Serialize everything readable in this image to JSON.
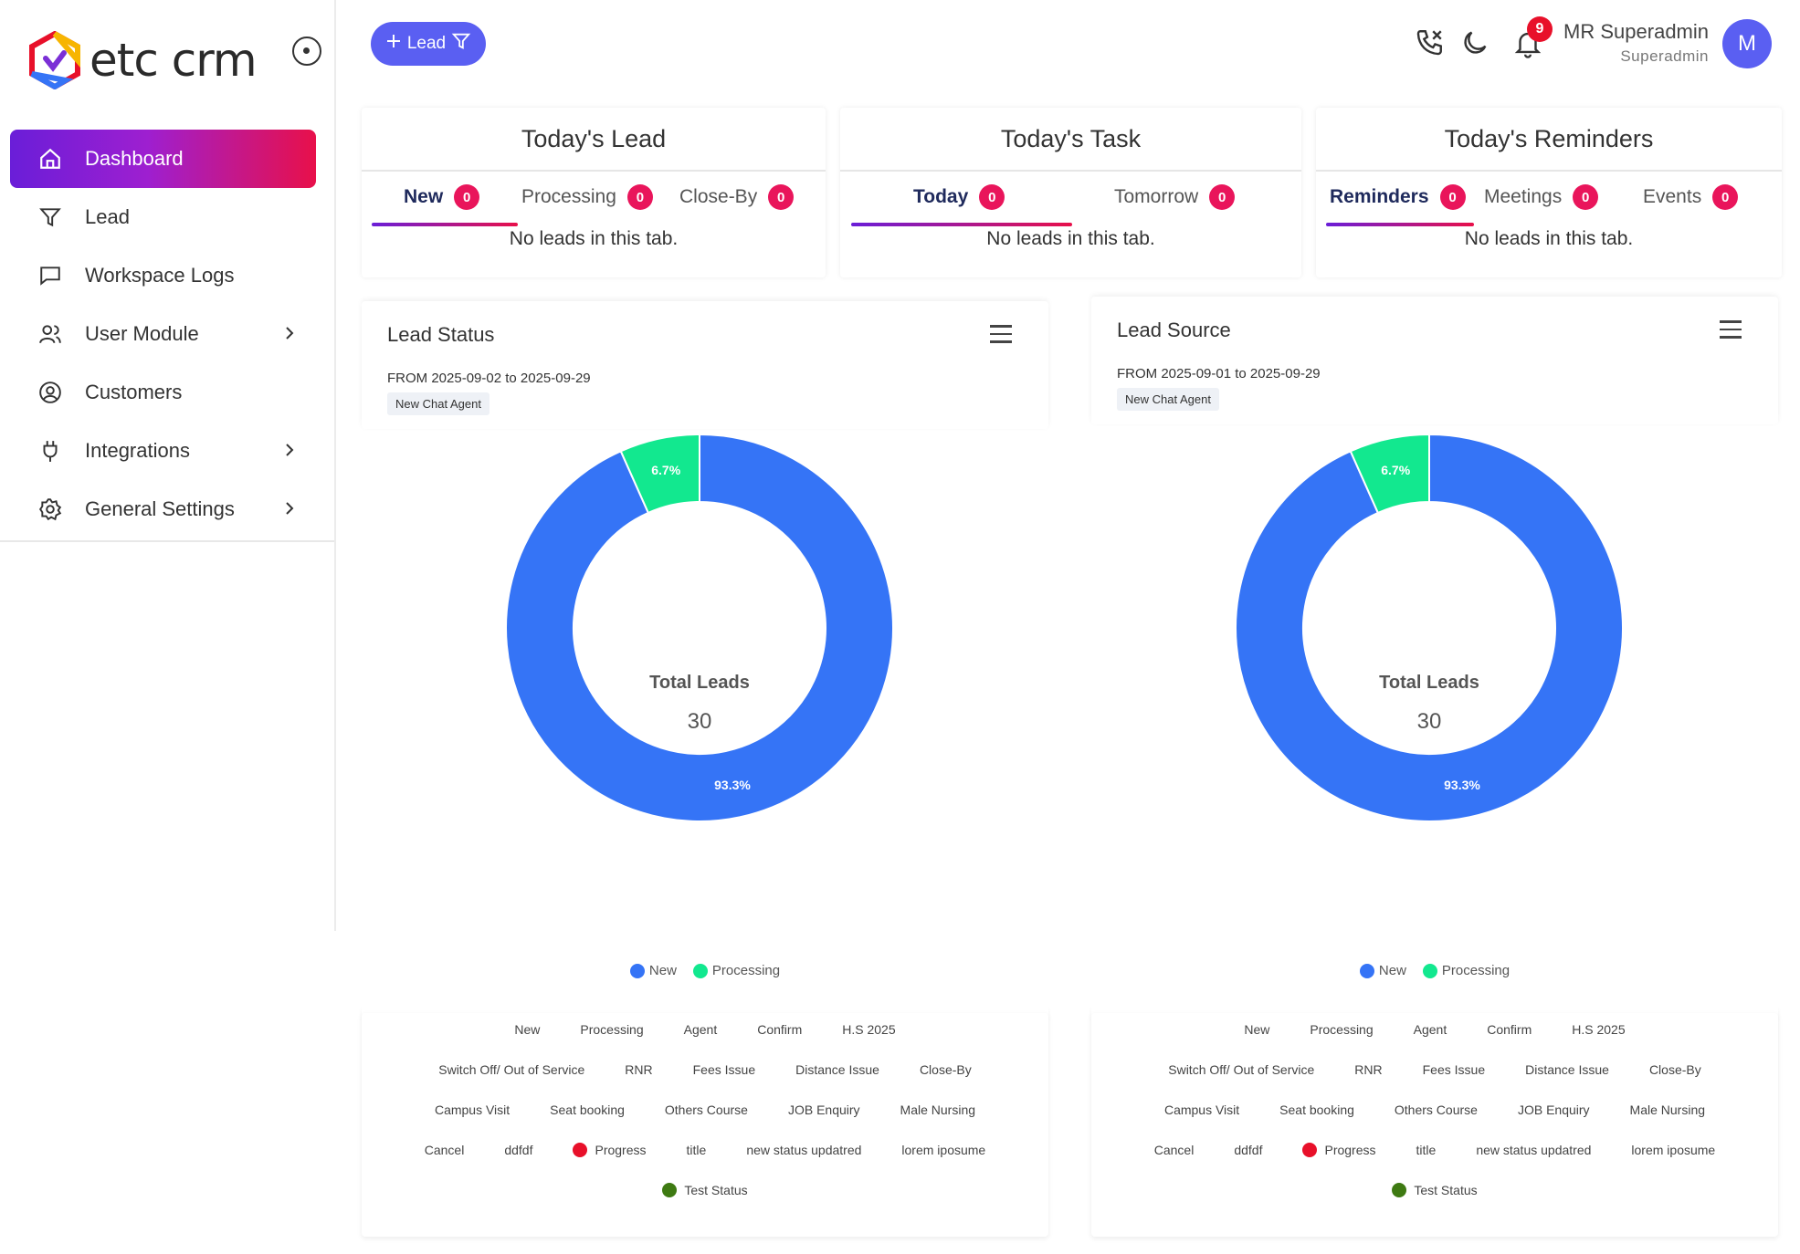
{
  "app": {
    "name": "etc crm"
  },
  "sidebar": {
    "items": [
      {
        "label": "Dashboard",
        "icon": "home-icon",
        "active": true
      },
      {
        "label": "Lead",
        "icon": "funnel-icon"
      },
      {
        "label": "Workspace Logs",
        "icon": "chat-icon"
      },
      {
        "label": "User Module",
        "icon": "users-icon",
        "expandable": true
      },
      {
        "label": "Customers",
        "icon": "user-circle-icon"
      },
      {
        "label": "Integrations",
        "icon": "plug-icon",
        "expandable": true
      },
      {
        "label": "General Settings",
        "icon": "gear-icon",
        "expandable": true
      }
    ]
  },
  "topbar": {
    "lead_button": "Lead",
    "notifications_count": "9",
    "user_name": "MR Superadmin",
    "user_role": "Superadmin",
    "avatar_initial": "M"
  },
  "cards": {
    "lead": {
      "title": "Today's Lead",
      "tabs": [
        {
          "label": "New",
          "count": "0"
        },
        {
          "label": "Processing",
          "count": "0"
        },
        {
          "label": "Close-By",
          "count": "0"
        }
      ],
      "empty": "No leads in this tab."
    },
    "task": {
      "title": "Today's Task",
      "tabs": [
        {
          "label": "Today",
          "count": "0"
        },
        {
          "label": "Tomorrow",
          "count": "0"
        }
      ],
      "empty": "No leads in this tab."
    },
    "reminders": {
      "title": "Today's Reminders",
      "tabs": [
        {
          "label": "Reminders",
          "count": "0"
        },
        {
          "label": "Meetings",
          "count": "0"
        },
        {
          "label": "Events",
          "count": "0"
        }
      ],
      "empty": "No leads in this tab."
    }
  },
  "charts": {
    "status": {
      "title": "Lead Status",
      "range": "FROM 2025-09-02 to 2025-09-29",
      "tag": "New Chat Agent",
      "center_label": "Total Leads",
      "center_value": "30",
      "slice_new": "93.3%",
      "slice_processing": "6.7%",
      "legend_new": "New",
      "legend_processing": "Processing"
    },
    "source": {
      "title": "Lead Source",
      "range": "FROM 2025-09-01 to 2025-09-29",
      "tag": "New Chat Agent",
      "center_label": "Total Leads",
      "center_value": "30",
      "slice_new": "93.3%",
      "slice_processing": "6.7%",
      "legend_new": "New",
      "legend_processing": "Processing"
    }
  },
  "statuses": {
    "row1": [
      "New",
      "Processing",
      "Agent",
      "Confirm",
      "H.S 2025"
    ],
    "row2": [
      "Switch Off/ Out of Service",
      "RNR",
      "Fees Issue",
      "Distance Issue",
      "Close-By"
    ],
    "row3": [
      "Campus Visit",
      "Seat booking",
      "Others Course",
      "JOB Enquiry",
      "Male Nursing"
    ],
    "row4": [
      "Cancel",
      "ddfdf",
      "Progress",
      "title",
      "new status updatred",
      "lorem iposume"
    ],
    "row5": [
      "Test Status"
    ]
  },
  "chart_data": [
    {
      "type": "pie",
      "title": "Lead Status",
      "categories": [
        "New",
        "Processing"
      ],
      "values": [
        28,
        2
      ],
      "percentages": [
        93.3,
        6.7
      ],
      "total": 30,
      "colors": [
        "#3574f6",
        "#12e88f"
      ],
      "legend": "bottom"
    },
    {
      "type": "pie",
      "title": "Lead Source",
      "categories": [
        "New",
        "Processing"
      ],
      "values": [
        28,
        2
      ],
      "percentages": [
        93.3,
        6.7
      ],
      "total": 30,
      "colors": [
        "#3574f6",
        "#12e88f"
      ],
      "legend": "bottom"
    }
  ],
  "colors": {
    "accent": "#5a5ff2",
    "badge": "#e9155b",
    "progress_dot": "#e8102a",
    "test_status_dot": "#3e7a12"
  }
}
